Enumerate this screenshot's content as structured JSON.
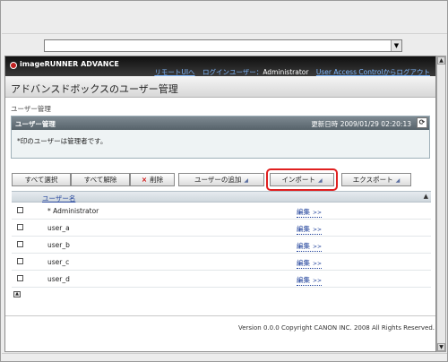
{
  "browser": {
    "address_value": "",
    "address_arrow": "▼"
  },
  "header": {
    "brand": "imageRUNNER ADVANCE",
    "remote_ui_link": "リモートUIへ",
    "login_user_label": "ログインユーザー：",
    "login_user_name": "Administrator",
    "logout_link": "User Access Controlからログアウト"
  },
  "page": {
    "title": "アドバンスドボックスのユーザー管理",
    "breadcrumb": "ユーザー管理"
  },
  "panel": {
    "title": "ユーザー管理",
    "updated": "更新日時 2009/01/29 02:20:13",
    "note": "*印のユーザーは管理者です。"
  },
  "toolbar": {
    "select_all": "すべて選択",
    "deselect_all": "すべて解除",
    "delete_icon": "×",
    "delete": "削除",
    "add_user": "ユーザーの追加",
    "import": "インポート",
    "export": "エクスポート",
    "dropdown_glyph": "◢"
  },
  "list": {
    "column_name": "ユーザー名",
    "sort_glyph": "▲",
    "edit_label": "編集",
    "edit_arrow": ">>",
    "rows": [
      {
        "name": "* Administrator"
      },
      {
        "name": "user_a"
      },
      {
        "name": "user_b"
      },
      {
        "name": "user_c"
      },
      {
        "name": "user_d"
      }
    ]
  },
  "footer": {
    "copyright": "Version 0.0.0 Copyright CANON INC. 2008 All Rights Reserved."
  },
  "icons": {
    "refresh": "⟳",
    "page_top": "▲"
  },
  "colors": {
    "highlight": "#e02020",
    "link": "#23449c",
    "header_bg": "#1a1a1a"
  }
}
